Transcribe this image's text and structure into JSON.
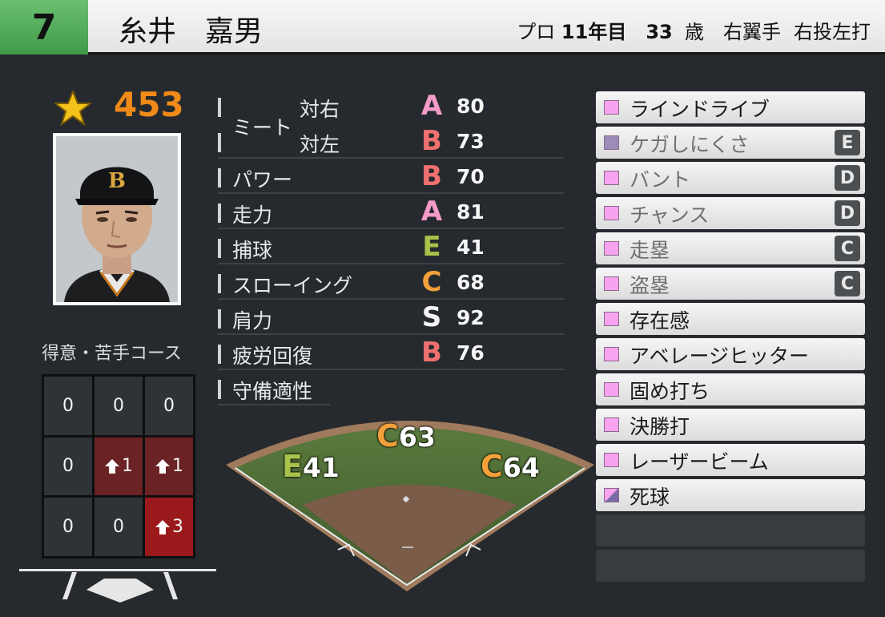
{
  "header": {
    "number": "7",
    "name": "糸井　嘉男",
    "year_label": "プロ",
    "year_value": "11年目",
    "age_value": "33",
    "age_unit": "歳",
    "position": "右翼手",
    "throw_bat": "右投左打"
  },
  "overall": {
    "value": "453",
    "icon": "star-icon"
  },
  "course": {
    "title": "得意・苦手コース",
    "cells": [
      {
        "value": "0",
        "hot": false
      },
      {
        "value": "0",
        "hot": false
      },
      {
        "value": "0",
        "hot": false
      },
      {
        "value": "0",
        "hot": false
      },
      {
        "value": "1",
        "hot": true,
        "level": 1
      },
      {
        "value": "1",
        "hot": true,
        "level": 1
      },
      {
        "value": "0",
        "hot": false
      },
      {
        "value": "0",
        "hot": false
      },
      {
        "value": "3",
        "hot": true,
        "level": 3
      }
    ]
  },
  "stats": {
    "meet_label": "ミート",
    "rows": [
      {
        "label": "対右",
        "grade": "A",
        "value": "80"
      },
      {
        "label": "対左",
        "grade": "B",
        "value": "73"
      },
      {
        "label": "パワー",
        "grade": "B",
        "value": "70"
      },
      {
        "label": "走力",
        "grade": "A",
        "value": "81"
      },
      {
        "label": "捕球",
        "grade": "E",
        "value": "41"
      },
      {
        "label": "スローイング",
        "grade": "C",
        "value": "68"
      },
      {
        "label": "肩力",
        "grade": "S",
        "value": "92"
      },
      {
        "label": "疲労回復",
        "grade": "B",
        "value": "76"
      },
      {
        "label": "守備適性",
        "grade": "",
        "value": ""
      }
    ]
  },
  "field": {
    "center": {
      "grade": "C",
      "value": "63"
    },
    "left": {
      "grade": "E",
      "value": "41"
    },
    "right": {
      "grade": "C",
      "value": "64"
    }
  },
  "abilities": [
    {
      "label": "ラインドライブ",
      "rank": "",
      "swatch": "pink",
      "dim": false
    },
    {
      "label": "ケガしにくさ",
      "rank": "E",
      "swatch": "gray",
      "dim": true
    },
    {
      "label": "バント",
      "rank": "D",
      "swatch": "pink",
      "dim": true
    },
    {
      "label": "チャンス",
      "rank": "D",
      "swatch": "pink",
      "dim": true
    },
    {
      "label": "走塁",
      "rank": "C",
      "swatch": "pink",
      "dim": true
    },
    {
      "label": "盗塁",
      "rank": "C",
      "swatch": "pink",
      "dim": true
    },
    {
      "label": "存在感",
      "rank": "",
      "swatch": "pink",
      "dim": false
    },
    {
      "label": "アベレージヒッター",
      "rank": "",
      "swatch": "pink",
      "dim": false
    },
    {
      "label": "固め打ち",
      "rank": "",
      "swatch": "pink",
      "dim": false
    },
    {
      "label": "決勝打",
      "rank": "",
      "swatch": "pink",
      "dim": false
    },
    {
      "label": "レーザービーム",
      "rank": "",
      "swatch": "pink",
      "dim": false
    },
    {
      "label": "死球",
      "rank": "",
      "swatch": "half",
      "dim": false
    }
  ],
  "colors": {
    "accent_green": "#4fa858",
    "overall_orange": "#f08a18"
  }
}
